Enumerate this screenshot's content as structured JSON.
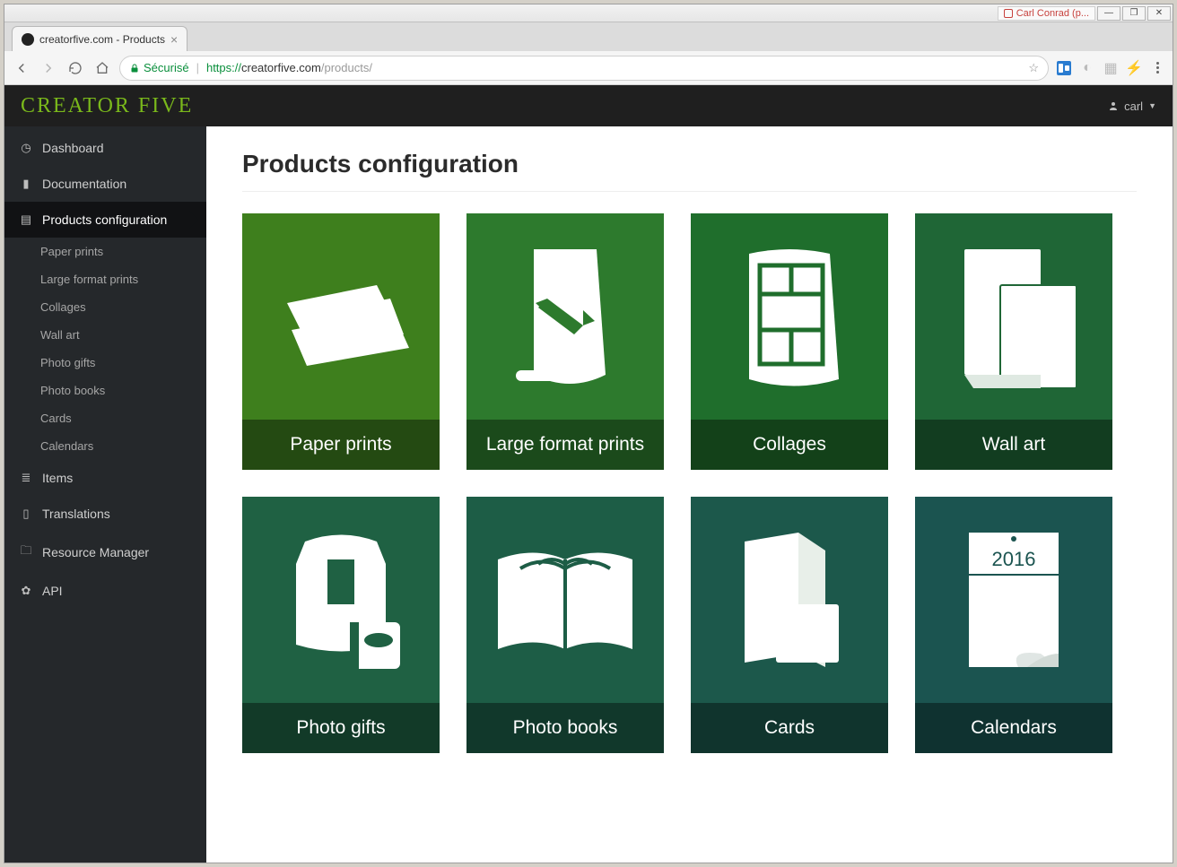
{
  "os": {
    "user_label": "Carl Conrad (p..."
  },
  "browser": {
    "tab_title": "creatorfive.com - Products",
    "secure_label": "Sécurisé",
    "url_protocol": "https://",
    "url_host": "creatorfive.com",
    "url_path": "/products/"
  },
  "header": {
    "brand": "CREATOR FIVE",
    "user": "carl"
  },
  "sidebar": {
    "items": [
      {
        "label": "Dashboard",
        "icon": "gauge"
      },
      {
        "label": "Documentation",
        "icon": "file"
      },
      {
        "label": "Products configuration",
        "icon": "book",
        "active": true
      },
      {
        "label": "Items",
        "icon": "list"
      },
      {
        "label": "Translations",
        "icon": "doc"
      },
      {
        "label": "Resource Manager",
        "icon": "folder"
      },
      {
        "label": "API",
        "icon": "gear"
      }
    ],
    "subitems": [
      {
        "label": "Paper prints"
      },
      {
        "label": "Large format prints"
      },
      {
        "label": "Collages"
      },
      {
        "label": "Wall art"
      },
      {
        "label": "Photo gifts"
      },
      {
        "label": "Photo books"
      },
      {
        "label": "Cards"
      },
      {
        "label": "Calendars"
      }
    ]
  },
  "main": {
    "title": "Products configuration",
    "tiles": [
      {
        "label": "Paper prints"
      },
      {
        "label": "Large format prints"
      },
      {
        "label": "Collages"
      },
      {
        "label": "Wall art"
      },
      {
        "label": "Photo gifts"
      },
      {
        "label": "Photo books"
      },
      {
        "label": "Cards"
      },
      {
        "label": "Calendars"
      }
    ],
    "calendar_year": "2016"
  }
}
